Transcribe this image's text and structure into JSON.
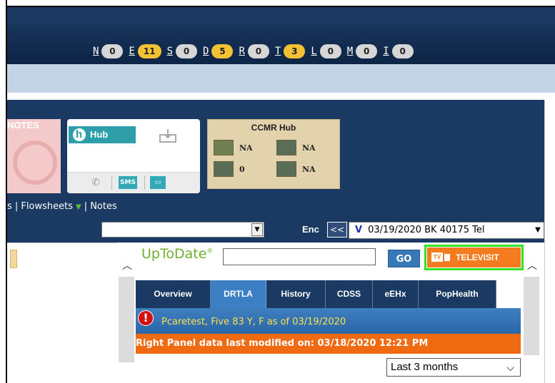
{
  "counters": [
    {
      "letter": "N",
      "count": "0",
      "state": "zero"
    },
    {
      "letter": "E",
      "count": "11",
      "state": "hot"
    },
    {
      "letter": "S",
      "count": "0",
      "state": "zero"
    },
    {
      "letter": "D",
      "count": "5",
      "state": "hot"
    },
    {
      "letter": "R",
      "count": "0",
      "state": "zero"
    },
    {
      "letter": "T",
      "count": "3",
      "state": "hot"
    },
    {
      "letter": "L",
      "count": "0",
      "state": "zero"
    },
    {
      "letter": "M",
      "count": "0",
      "state": "zero"
    },
    {
      "letter": "I",
      "count": "0",
      "state": "zero"
    }
  ],
  "tiles": {
    "notes_label": "NOTES",
    "hub_label": "Hub",
    "sms_label": "SMS",
    "ccmr": {
      "title": "CCMR Hub",
      "values": [
        "NA",
        "NA",
        "0",
        "NA"
      ]
    }
  },
  "links": {
    "part1": "s | Flowsheets",
    "part2": "| Notes"
  },
  "encounter": {
    "label": "Enc",
    "prev": "<<",
    "type_letter": "V",
    "value": "03/19/2020 BK 40175 Tel"
  },
  "uptodate": {
    "brand": "UpToDate",
    "trademark": "®",
    "go": "GO"
  },
  "televisit": {
    "label": "TELEVISIT",
    "tv_icon_text": "TV"
  },
  "tabs": [
    "Overview",
    "DRTLA",
    "History",
    "CDSS",
    "eEHx",
    "PopHealth"
  ],
  "active_tab": "DRTLA",
  "patient": {
    "summary": "Pcaretest, Five 83 Y, F as of 03/19/2020"
  },
  "modified": "Right Panel data last modified on: 03/18/2020 12:21 PM",
  "range_select": "Last 3 months",
  "colors": {
    "navy": "#1b3a63",
    "pill_hot": "#f3c134",
    "orange": "#f06a12",
    "televisit_border": "#36e025",
    "uptodate_green": "#6fb02f"
  }
}
